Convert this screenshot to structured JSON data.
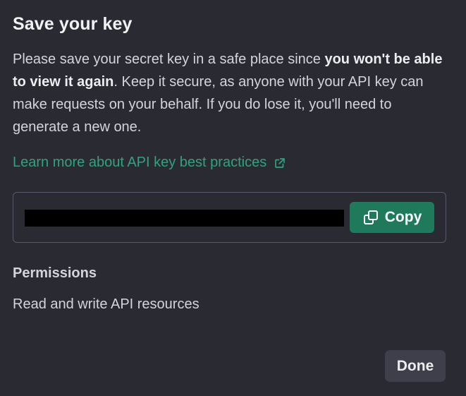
{
  "dialog": {
    "title": "Save your key",
    "description": {
      "part1": "Please save your secret key in a safe place since ",
      "bold": "you won't be able to view it again",
      "part2": ". Keep it secure, as anyone with your API key can make requests on your behalf. If you do lose it, you'll need to generate a new one."
    },
    "learn_more_label": "Learn more about API key best practices",
    "learn_more_icon": "external-link-icon",
    "copy_label": "Copy",
    "copy_icon": "copy-icon",
    "permissions_label": "Permissions",
    "permissions_value": "Read and write API resources",
    "done_label": "Done"
  },
  "colors": {
    "background": "#2a2b32",
    "accent": "#2fa37f",
    "copy_button": "#1f7a5c",
    "done_button": "#3e3f4b",
    "key_mask": "#000000"
  }
}
